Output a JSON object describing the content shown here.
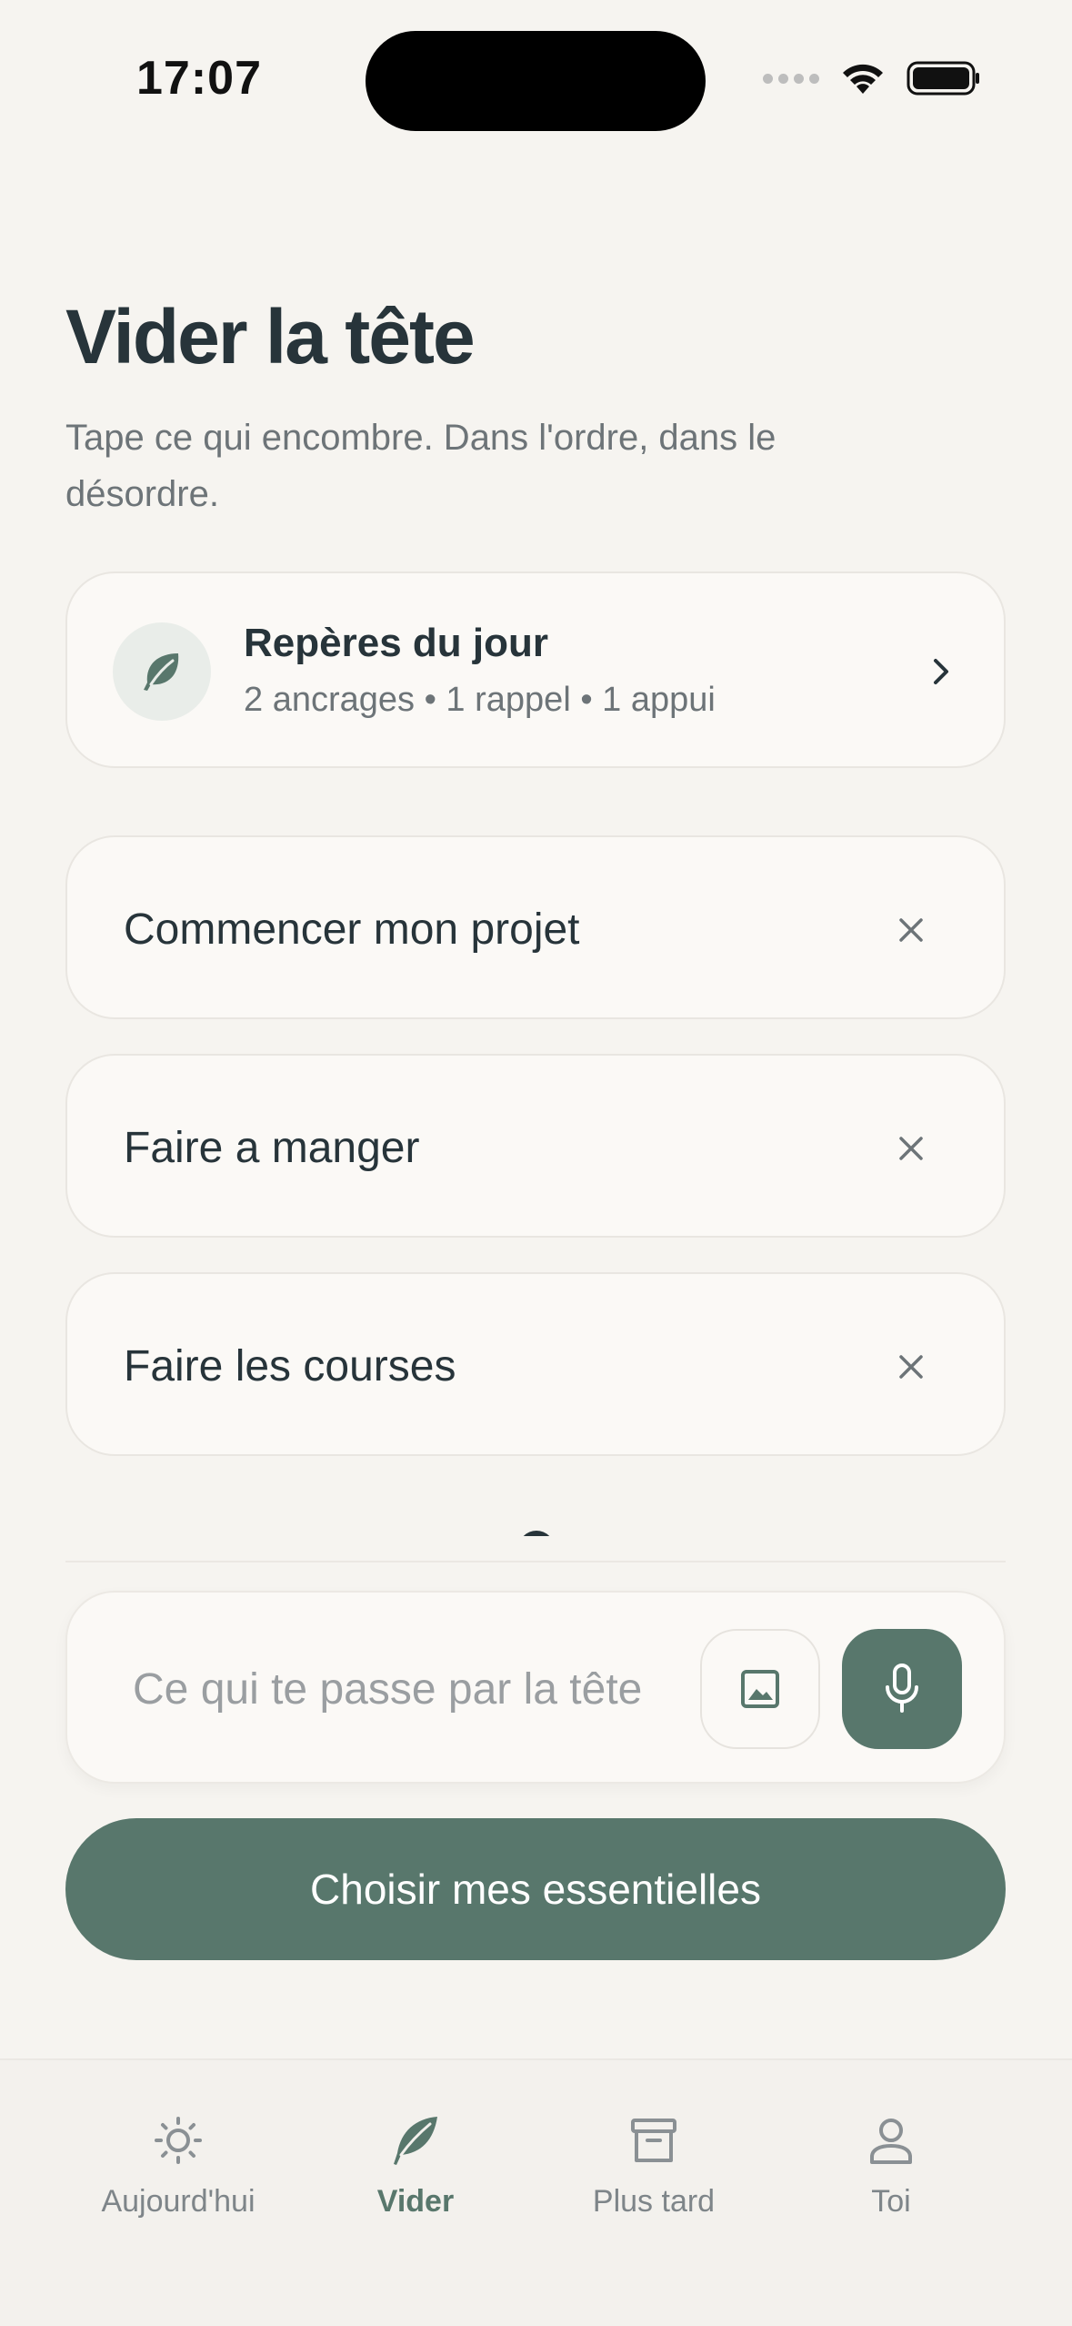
{
  "status_bar": {
    "time": "17:07"
  },
  "header": {
    "title": "Vider la tête",
    "subtitle": "Tape ce qui encombre. Dans l'ordre, dans le désordre."
  },
  "reperes": {
    "title": "Repères du jour",
    "summary": "2 ancrages • 1 rappel • 1 appui"
  },
  "items": [
    {
      "text": "Commencer mon projet"
    },
    {
      "text": "Faire a manger"
    },
    {
      "text": "Faire les courses"
    }
  ],
  "composer": {
    "placeholder": "Ce qui te passe par la tête"
  },
  "primary_button": {
    "label": "Choisir mes essentielles"
  },
  "tabs": [
    {
      "label": "Aujourd'hui",
      "icon": "sun-icon",
      "active": false
    },
    {
      "label": "Vider",
      "icon": "feather-icon",
      "active": true
    },
    {
      "label": "Plus tard",
      "icon": "archive-icon",
      "active": false
    },
    {
      "label": "Toi",
      "icon": "person-icon",
      "active": false
    }
  ],
  "colors": {
    "accent": "#58776c",
    "background": "#f6f4f0",
    "card": "#fbf9f6",
    "text_primary": "#27343a",
    "text_secondary": "#6d7478"
  }
}
